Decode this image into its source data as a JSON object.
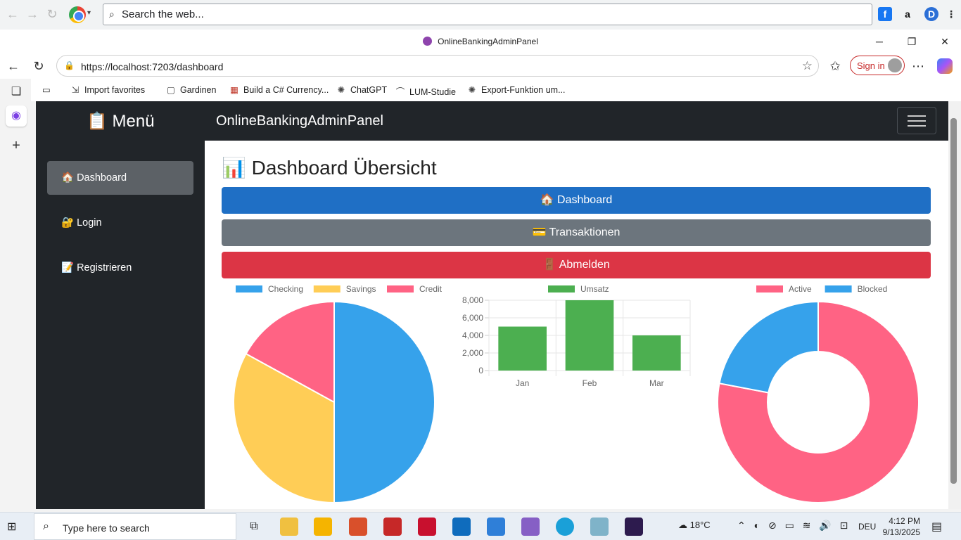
{
  "browser": {
    "search_placeholder": "Search the web...",
    "window_title": "OnlineBankingAdminPanel",
    "url": "https://localhost:7203/dashboard",
    "sign_in": "Sign in",
    "favorites": [
      {
        "icon": "import-icon",
        "label": "Import favorites"
      },
      {
        "icon": "folder-icon",
        "label": "Gardinen"
      },
      {
        "icon": "calendar-icon",
        "label": "Build a C# Currency..."
      },
      {
        "icon": "openai-icon",
        "label": "ChatGPT"
      },
      {
        "icon": "link-icon",
        "label": "LUM-Studie"
      },
      {
        "icon": "openai-icon",
        "label": "Export-Funktion um..."
      }
    ]
  },
  "page": {
    "menu_title": "📋 Menü",
    "app_title": "OnlineBankingAdminPanel",
    "sidebar": [
      {
        "label": "🏠 Dashboard",
        "active": true
      },
      {
        "label": "🔐 Login",
        "active": false
      },
      {
        "label": "📝 Registrieren",
        "active": false
      }
    ],
    "heading": "📊 Dashboard Übersicht",
    "buttons": {
      "dashboard": "🏠 Dashboard",
      "transactions": "💳 Transaktionen",
      "logout": "🚪 Abmelden"
    },
    "colors": {
      "primary": "#1f6fc5",
      "secondary": "#6c757d",
      "danger": "#dc3545"
    }
  },
  "chart_data": [
    {
      "type": "pie",
      "legend_position": "top",
      "labels": [
        "Checking",
        "Savings",
        "Credit"
      ],
      "values": [
        50,
        33,
        17
      ],
      "colors": [
        "#36a2eb",
        "#ffcd56",
        "#ff6384"
      ]
    },
    {
      "type": "bar",
      "legend_position": "top",
      "categories": [
        "Jan",
        "Feb",
        "Mar"
      ],
      "series": [
        {
          "name": "Umsatz",
          "values": [
            5000,
            8000,
            4000
          ],
          "color": "#4caf50"
        }
      ],
      "ylim": [
        0,
        8000
      ],
      "yticks": [
        "8,000",
        "6,000",
        "4,000",
        "2,000",
        "0"
      ],
      "ytick_values": [
        8000,
        6000,
        4000,
        2000,
        0
      ],
      "grid": true
    },
    {
      "type": "pie",
      "variant": "doughnut",
      "legend_position": "top",
      "labels": [
        "Active",
        "Blocked"
      ],
      "values": [
        78,
        22
      ],
      "colors": [
        "#ff6384",
        "#36a2eb"
      ]
    }
  ],
  "taskbar": {
    "search_placeholder": "Type here to search",
    "weather": "18°C",
    "lang": "DEU",
    "time": "4:12 PM",
    "date": "9/13/2025"
  }
}
